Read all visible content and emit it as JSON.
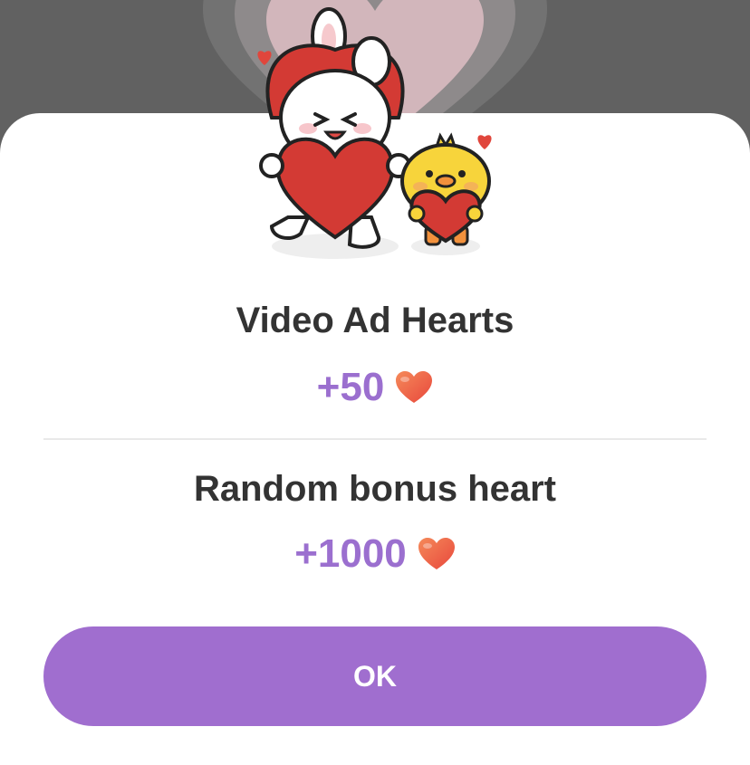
{
  "dialog": {
    "video_ad": {
      "title": "Video Ad Hearts",
      "amount": "+50"
    },
    "bonus": {
      "title": "Random bonus heart",
      "amount": "+1000"
    },
    "ok_label": "OK"
  },
  "icons": {
    "reward": "heart-icon",
    "illustration": "bunny-and-chick-holding-hearts"
  },
  "colors": {
    "backdrop": "#616161",
    "accent": "#a06ecf",
    "amount_text": "#9b6fcf",
    "title_text": "#333333",
    "heart": "#f0613f"
  }
}
